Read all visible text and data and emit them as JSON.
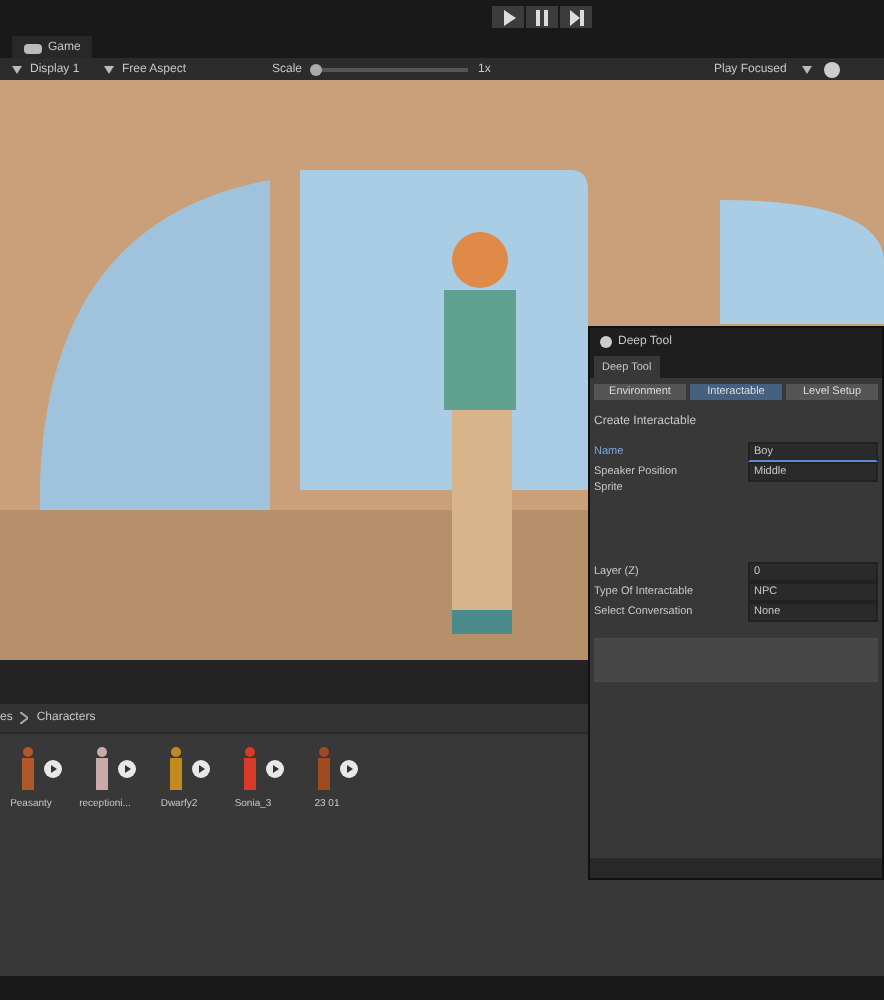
{
  "toolbar": {
    "play_controls": [
      {
        "kind": "play"
      },
      {
        "kind": "pause"
      },
      {
        "kind": "step"
      }
    ]
  },
  "game_view": {
    "tab": "Game",
    "display": "Display 1",
    "aspect": "Free Aspect",
    "scale_label": "Scale",
    "scale": {
      "level": 0.03
    },
    "scale_value": "1x",
    "play_mode": "Play Focused"
  },
  "deep_tool": {
    "title": "Deep Tool",
    "tab": "Deep Tool",
    "tabs": [
      {
        "label": "Environment",
        "selected": false
      },
      {
        "label": "Interactable",
        "selected": true
      },
      {
        "label": "Level Setup",
        "selected": false
      }
    ],
    "section": "Create Interactable",
    "fields": [
      {
        "kind": "text",
        "label": "Name",
        "value": "Boy",
        "focused": true
      },
      {
        "kind": "text",
        "label": "Speaker Position",
        "value": "Middle",
        "focused": false
      },
      {
        "kind": "sprite",
        "label": "Sprite",
        "focused": false
      },
      {
        "kind": "text",
        "label": "Layer (Z)",
        "value": "0",
        "focused": false
      },
      {
        "kind": "text",
        "label": "Type Of Interactable",
        "value": "NPC",
        "focused": false
      },
      {
        "kind": "text",
        "label": "Select Conversation",
        "value": "None",
        "focused": false
      }
    ]
  },
  "project": {
    "breadcrumb": [
      "es",
      "Characters"
    ],
    "items": [
      {
        "name": "Peasanty",
        "color": "#b0582a"
      },
      {
        "name": "receptioni...",
        "color": "#c8aaa8"
      },
      {
        "name": "Dwarfy2",
        "color": "#c08a20"
      },
      {
        "name": "Sonia_3",
        "color": "#d83a28"
      },
      {
        "name": "23 01",
        "color": "#a04a22"
      }
    ]
  }
}
